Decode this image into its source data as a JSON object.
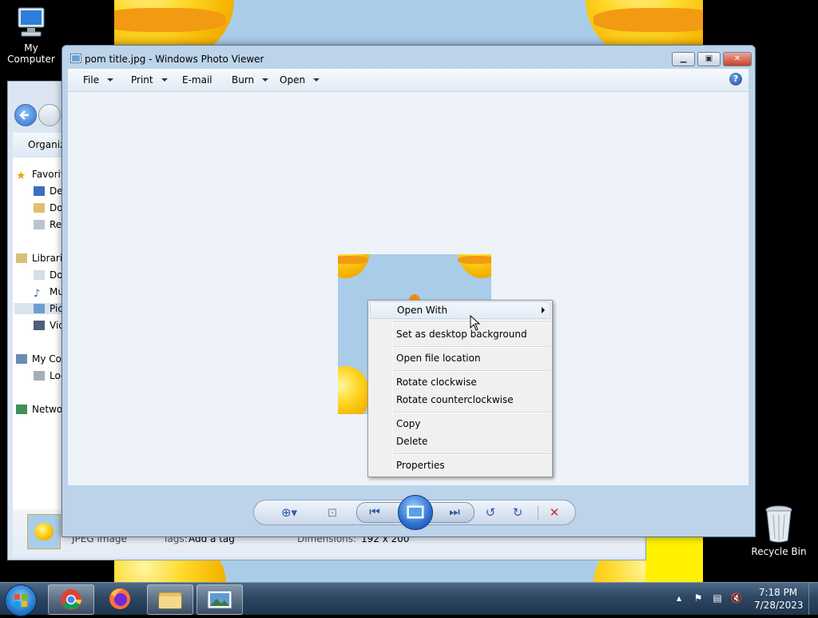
{
  "desktop": {
    "icons": [
      {
        "label": "My Computer"
      },
      {
        "label": "Recycle Bin"
      }
    ]
  },
  "explorer": {
    "toolbar_label": "Organize",
    "sidebar": [
      {
        "label": "Favorites"
      },
      {
        "label": "Desktop"
      },
      {
        "label": "Downloads"
      },
      {
        "label": "Recent Places"
      },
      {
        "label": "Libraries"
      },
      {
        "label": "Documents"
      },
      {
        "label": "Music"
      },
      {
        "label": "Pictures"
      },
      {
        "label": "Videos"
      },
      {
        "label": "My Computer"
      },
      {
        "label": "Local Disk"
      },
      {
        "label": "Network"
      }
    ],
    "details": {
      "file_type": "JPEG image",
      "tags_label": "Tags:",
      "tags_value": "Add a tag",
      "dimensions_label": "Dimensions:",
      "dimensions_value": "192 x 200"
    }
  },
  "viewer": {
    "title": "pom title.jpg - Windows Photo Viewer",
    "menu": [
      {
        "label": "File",
        "dropdown": true
      },
      {
        "label": "Print",
        "dropdown": true
      },
      {
        "label": "E-mail",
        "dropdown": false
      },
      {
        "label": "Burn",
        "dropdown": true
      },
      {
        "label": "Open",
        "dropdown": true
      }
    ]
  },
  "context_menu": {
    "items": [
      {
        "label": "Open With",
        "submenu": true
      },
      {
        "label": "Set as desktop background"
      },
      {
        "label": "Open file location"
      },
      {
        "label": "Rotate clockwise"
      },
      {
        "label": "Rotate counterclockwise"
      },
      {
        "label": "Copy"
      },
      {
        "label": "Delete"
      },
      {
        "label": "Properties"
      }
    ]
  },
  "taskbar": {
    "time": "7:18 PM",
    "date": "7/28/2023"
  },
  "colors": {
    "taskbar": "#2d4763",
    "viewer_frame": "#bcd3ea",
    "close_button": "#c8412b",
    "delete_icon": "#d22a2a"
  }
}
